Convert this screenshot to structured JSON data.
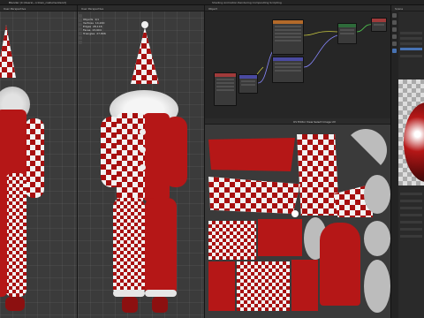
{
  "window": {
    "title": "Blender [C:\\Users\\...\\clown_costume.blend]",
    "menu": "Shading   Animation   Rendering   Compositing   Scripting"
  },
  "viewport_left": {
    "header": "User Perspective"
  },
  "viewport_mid": {
    "header": "User Perspective",
    "overlay": "Objects  1/1\nVertices  14,220\nEdges  28,116\nFaces  13,904\nTriangles  27,806"
  },
  "node_editor": {
    "header": "Object"
  },
  "uv_editor": {
    "header": "UV Editor   View   Select   Image   UV"
  },
  "properties": {
    "header": "Scene"
  },
  "icons": [
    "cursor-icon",
    "move-icon",
    "rotate-icon",
    "scale-icon",
    "transform-icon",
    "annotate-icon",
    "measure-icon"
  ],
  "colors": {
    "accent": "#4772b3",
    "costume_red": "#b51717",
    "node_green": "#2e6a3a",
    "node_orange": "#b36a2a"
  }
}
